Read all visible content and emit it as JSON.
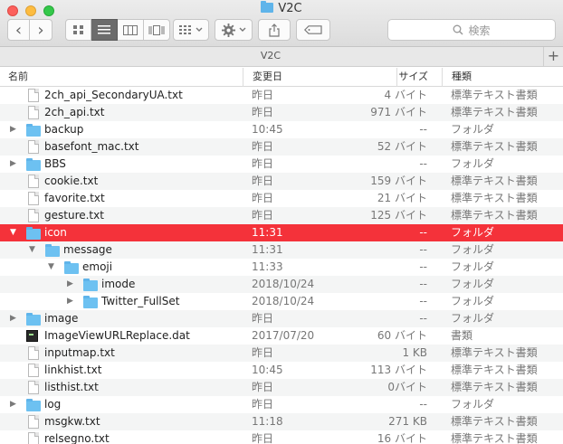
{
  "window": {
    "title": "V2C"
  },
  "toolbar": {
    "back_glyph": "‹",
    "forward_glyph": "›",
    "search_placeholder": "検索"
  },
  "pathbar": {
    "title": "V2C",
    "add_glyph": "+"
  },
  "columns": {
    "name": "名前",
    "date": "変更日",
    "size": "サイズ",
    "kind": "種類"
  },
  "colors": {
    "selection": "#f4323a",
    "folder": "#6dc1f1"
  },
  "rows": [
    {
      "name": "2ch_api_SecondaryUA.txt",
      "date": "昨日",
      "size": "4 バイト",
      "kind": "標準テキスト書類",
      "icon": "doc",
      "depth": 0,
      "disclosure": "none"
    },
    {
      "name": "2ch_api.txt",
      "date": "昨日",
      "size": "971 バイト",
      "kind": "標準テキスト書類",
      "icon": "doc",
      "depth": 0,
      "disclosure": "none"
    },
    {
      "name": "backup",
      "date": "10:45",
      "size": "--",
      "kind": "フォルダ",
      "icon": "folder",
      "depth": 0,
      "disclosure": "collapsed"
    },
    {
      "name": "basefont_mac.txt",
      "date": "昨日",
      "size": "52 バイト",
      "kind": "標準テキスト書類",
      "icon": "doc",
      "depth": 0,
      "disclosure": "none"
    },
    {
      "name": "BBS",
      "date": "昨日",
      "size": "--",
      "kind": "フォルダ",
      "icon": "folder",
      "depth": 0,
      "disclosure": "collapsed"
    },
    {
      "name": "cookie.txt",
      "date": "昨日",
      "size": "159 バイト",
      "kind": "標準テキスト書類",
      "icon": "doc",
      "depth": 0,
      "disclosure": "none"
    },
    {
      "name": "favorite.txt",
      "date": "昨日",
      "size": "21 バイト",
      "kind": "標準テキスト書類",
      "icon": "doc",
      "depth": 0,
      "disclosure": "none"
    },
    {
      "name": "gesture.txt",
      "date": "昨日",
      "size": "125 バイト",
      "kind": "標準テキスト書類",
      "icon": "doc",
      "depth": 0,
      "disclosure": "none"
    },
    {
      "name": "icon",
      "date": "11:31",
      "size": "--",
      "kind": "フォルダ",
      "icon": "folder",
      "depth": 0,
      "disclosure": "expanded",
      "selected": true
    },
    {
      "name": "message",
      "date": "11:31",
      "size": "--",
      "kind": "フォルダ",
      "icon": "folder",
      "depth": 1,
      "disclosure": "expanded"
    },
    {
      "name": "emoji",
      "date": "11:33",
      "size": "--",
      "kind": "フォルダ",
      "icon": "folder",
      "depth": 2,
      "disclosure": "expanded"
    },
    {
      "name": "imode",
      "date": "2018/10/24",
      "size": "--",
      "kind": "フォルダ",
      "icon": "folder",
      "depth": 3,
      "disclosure": "collapsed"
    },
    {
      "name": "Twitter_FullSet",
      "date": "2018/10/24",
      "size": "--",
      "kind": "フォルダ",
      "icon": "folder",
      "depth": 3,
      "disclosure": "collapsed"
    },
    {
      "name": "image",
      "date": "昨日",
      "size": "--",
      "kind": "フォルダ",
      "icon": "folder",
      "depth": 0,
      "disclosure": "collapsed"
    },
    {
      "name": "ImageViewURLReplace.dat",
      "date": "2017/07/20",
      "size": "60 バイト",
      "kind": "書類",
      "icon": "exe",
      "depth": 0,
      "disclosure": "none"
    },
    {
      "name": "inputmap.txt",
      "date": "昨日",
      "size": "1 KB",
      "kind": "標準テキスト書類",
      "icon": "doc",
      "depth": 0,
      "disclosure": "none"
    },
    {
      "name": "linkhist.txt",
      "date": "10:45",
      "size": "113 バイト",
      "kind": "標準テキスト書類",
      "icon": "doc",
      "depth": 0,
      "disclosure": "none"
    },
    {
      "name": "listhist.txt",
      "date": "昨日",
      "size": "0バイト",
      "kind": "標準テキスト書類",
      "icon": "doc",
      "depth": 0,
      "disclosure": "none"
    },
    {
      "name": "log",
      "date": "昨日",
      "size": "--",
      "kind": "フォルダ",
      "icon": "folder",
      "depth": 0,
      "disclosure": "collapsed"
    },
    {
      "name": "msgkw.txt",
      "date": "11:18",
      "size": "271 KB",
      "kind": "標準テキスト書類",
      "icon": "doc",
      "depth": 0,
      "disclosure": "none"
    },
    {
      "name": "relsegno.txt",
      "date": "昨日",
      "size": "16 バイト",
      "kind": "標準テキスト書類",
      "icon": "doc",
      "depth": 0,
      "disclosure": "none"
    }
  ]
}
